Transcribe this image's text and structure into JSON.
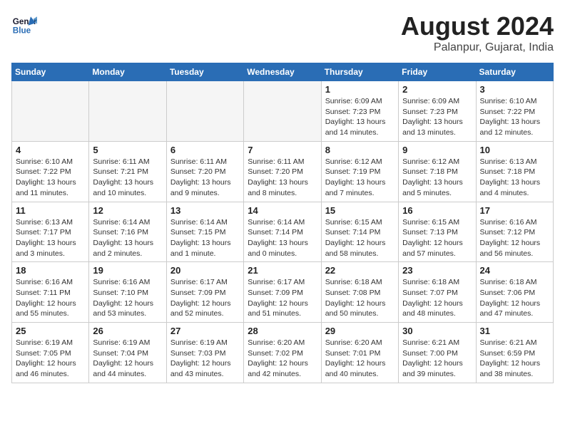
{
  "logo": {
    "line1": "General",
    "line2": "Blue"
  },
  "title": "August 2024",
  "subtitle": "Palanpur, Gujarat, India",
  "weekdays": [
    "Sunday",
    "Monday",
    "Tuesday",
    "Wednesday",
    "Thursday",
    "Friday",
    "Saturday"
  ],
  "weeks": [
    [
      {
        "day": "",
        "info": ""
      },
      {
        "day": "",
        "info": ""
      },
      {
        "day": "",
        "info": ""
      },
      {
        "day": "",
        "info": ""
      },
      {
        "day": "1",
        "info": "Sunrise: 6:09 AM\nSunset: 7:23 PM\nDaylight: 13 hours\nand 14 minutes."
      },
      {
        "day": "2",
        "info": "Sunrise: 6:09 AM\nSunset: 7:23 PM\nDaylight: 13 hours\nand 13 minutes."
      },
      {
        "day": "3",
        "info": "Sunrise: 6:10 AM\nSunset: 7:22 PM\nDaylight: 13 hours\nand 12 minutes."
      }
    ],
    [
      {
        "day": "4",
        "info": "Sunrise: 6:10 AM\nSunset: 7:22 PM\nDaylight: 13 hours\nand 11 minutes."
      },
      {
        "day": "5",
        "info": "Sunrise: 6:11 AM\nSunset: 7:21 PM\nDaylight: 13 hours\nand 10 minutes."
      },
      {
        "day": "6",
        "info": "Sunrise: 6:11 AM\nSunset: 7:20 PM\nDaylight: 13 hours\nand 9 minutes."
      },
      {
        "day": "7",
        "info": "Sunrise: 6:11 AM\nSunset: 7:20 PM\nDaylight: 13 hours\nand 8 minutes."
      },
      {
        "day": "8",
        "info": "Sunrise: 6:12 AM\nSunset: 7:19 PM\nDaylight: 13 hours\nand 7 minutes."
      },
      {
        "day": "9",
        "info": "Sunrise: 6:12 AM\nSunset: 7:18 PM\nDaylight: 13 hours\nand 5 minutes."
      },
      {
        "day": "10",
        "info": "Sunrise: 6:13 AM\nSunset: 7:18 PM\nDaylight: 13 hours\nand 4 minutes."
      }
    ],
    [
      {
        "day": "11",
        "info": "Sunrise: 6:13 AM\nSunset: 7:17 PM\nDaylight: 13 hours\nand 3 minutes."
      },
      {
        "day": "12",
        "info": "Sunrise: 6:14 AM\nSunset: 7:16 PM\nDaylight: 13 hours\nand 2 minutes."
      },
      {
        "day": "13",
        "info": "Sunrise: 6:14 AM\nSunset: 7:15 PM\nDaylight: 13 hours\nand 1 minute."
      },
      {
        "day": "14",
        "info": "Sunrise: 6:14 AM\nSunset: 7:14 PM\nDaylight: 13 hours\nand 0 minutes."
      },
      {
        "day": "15",
        "info": "Sunrise: 6:15 AM\nSunset: 7:14 PM\nDaylight: 12 hours\nand 58 minutes."
      },
      {
        "day": "16",
        "info": "Sunrise: 6:15 AM\nSunset: 7:13 PM\nDaylight: 12 hours\nand 57 minutes."
      },
      {
        "day": "17",
        "info": "Sunrise: 6:16 AM\nSunset: 7:12 PM\nDaylight: 12 hours\nand 56 minutes."
      }
    ],
    [
      {
        "day": "18",
        "info": "Sunrise: 6:16 AM\nSunset: 7:11 PM\nDaylight: 12 hours\nand 55 minutes."
      },
      {
        "day": "19",
        "info": "Sunrise: 6:16 AM\nSunset: 7:10 PM\nDaylight: 12 hours\nand 53 minutes."
      },
      {
        "day": "20",
        "info": "Sunrise: 6:17 AM\nSunset: 7:09 PM\nDaylight: 12 hours\nand 52 minutes."
      },
      {
        "day": "21",
        "info": "Sunrise: 6:17 AM\nSunset: 7:09 PM\nDaylight: 12 hours\nand 51 minutes."
      },
      {
        "day": "22",
        "info": "Sunrise: 6:18 AM\nSunset: 7:08 PM\nDaylight: 12 hours\nand 50 minutes."
      },
      {
        "day": "23",
        "info": "Sunrise: 6:18 AM\nSunset: 7:07 PM\nDaylight: 12 hours\nand 48 minutes."
      },
      {
        "day": "24",
        "info": "Sunrise: 6:18 AM\nSunset: 7:06 PM\nDaylight: 12 hours\nand 47 minutes."
      }
    ],
    [
      {
        "day": "25",
        "info": "Sunrise: 6:19 AM\nSunset: 7:05 PM\nDaylight: 12 hours\nand 46 minutes."
      },
      {
        "day": "26",
        "info": "Sunrise: 6:19 AM\nSunset: 7:04 PM\nDaylight: 12 hours\nand 44 minutes."
      },
      {
        "day": "27",
        "info": "Sunrise: 6:19 AM\nSunset: 7:03 PM\nDaylight: 12 hours\nand 43 minutes."
      },
      {
        "day": "28",
        "info": "Sunrise: 6:20 AM\nSunset: 7:02 PM\nDaylight: 12 hours\nand 42 minutes."
      },
      {
        "day": "29",
        "info": "Sunrise: 6:20 AM\nSunset: 7:01 PM\nDaylight: 12 hours\nand 40 minutes."
      },
      {
        "day": "30",
        "info": "Sunrise: 6:21 AM\nSunset: 7:00 PM\nDaylight: 12 hours\nand 39 minutes."
      },
      {
        "day": "31",
        "info": "Sunrise: 6:21 AM\nSunset: 6:59 PM\nDaylight: 12 hours\nand 38 minutes."
      }
    ]
  ]
}
